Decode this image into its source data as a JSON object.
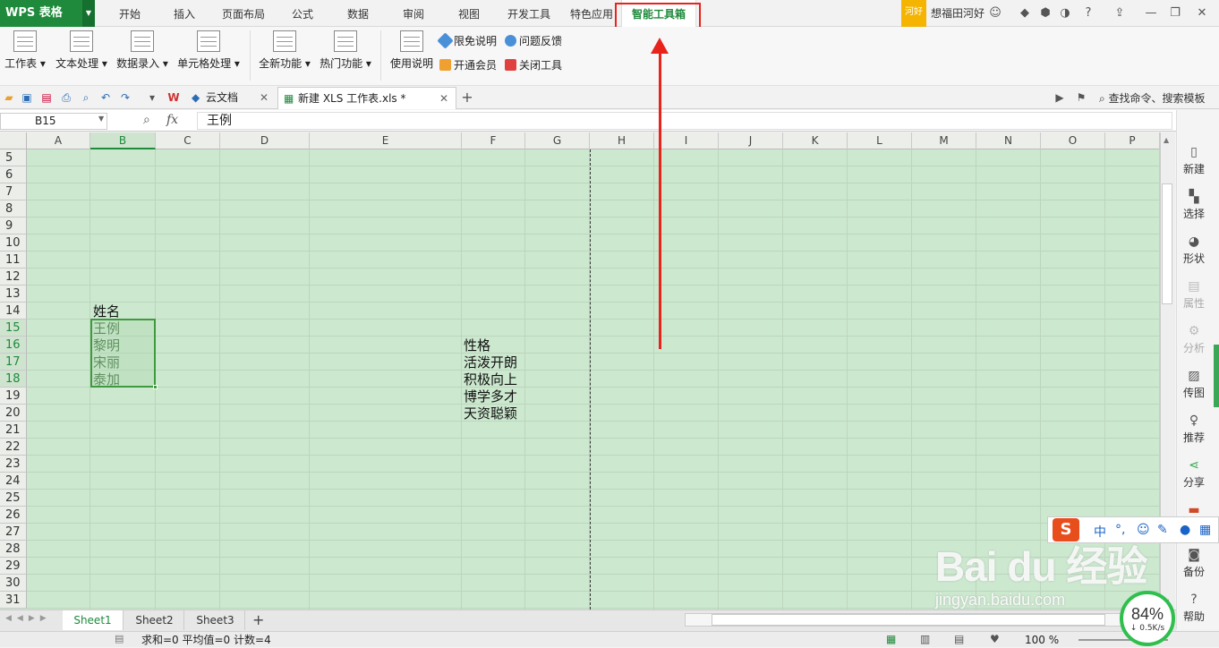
{
  "app": {
    "logo": "WPS 表格"
  },
  "menu_tabs": [
    "开始",
    "插入",
    "页面布局",
    "公式",
    "数据",
    "审阅",
    "视图",
    "开发工具",
    "特色应用",
    "智能工具箱"
  ],
  "active_tab": "智能工具箱",
  "topbar": {
    "badge": "河好",
    "user": "想福田河好"
  },
  "ribbon": {
    "groups1": [
      "工作表",
      "文本处理",
      "数据录入",
      "单元格处理"
    ],
    "groups2": [
      "全新功能",
      "热门功能"
    ],
    "usage": "使用说明",
    "small": [
      "限免说明",
      "问题反馈",
      "开通会员",
      "关闭工具"
    ]
  },
  "doc_tabs": {
    "cloud": "云文档",
    "file": "新建 XLS 工作表.xls *",
    "search": "查找命令、搜索模板"
  },
  "formula_bar": {
    "cell_ref": "B15",
    "fx": "fx",
    "value": "王例"
  },
  "columns": [
    "A",
    "B",
    "C",
    "D",
    "E",
    "F",
    "G",
    "H",
    "I",
    "J",
    "K",
    "L",
    "M",
    "N",
    "O",
    "P"
  ],
  "rows": [
    "5",
    "6",
    "7",
    "8",
    "9",
    "10",
    "11",
    "12",
    "13",
    "14",
    "15",
    "16",
    "17",
    "18",
    "19",
    "20",
    "21",
    "22",
    "23",
    "24",
    "25",
    "26",
    "27",
    "28",
    "29",
    "30",
    "31"
  ],
  "cells": {
    "b14": "姓名",
    "b15": "王例",
    "b16": "黎明",
    "b17": "宋丽",
    "b18": "泰加",
    "f16": "性格",
    "f17": "活泼开朗",
    "f18": "积极向上",
    "f19": "博学多才",
    "f20": "天资聪颖"
  },
  "right_panel": [
    "新建",
    "选择",
    "形状",
    "属性",
    "分析",
    "传图",
    "推荐",
    "分享",
    "备份",
    "帮助"
  ],
  "sheets": [
    "Sheet1",
    "Sheet2",
    "Sheet3"
  ],
  "status": {
    "summary": "求和=0  平均值=0  计数=4",
    "zoom": "100 %"
  },
  "speed": {
    "value": "84%",
    "rate": "↓ 0.5K/s"
  },
  "ime": {
    "mode": "中",
    "punct": "°,"
  },
  "watermark": {
    "brand": "Bai du 经验",
    "url": "jingyan.baidu.com"
  },
  "colors": {
    "accent": "#1f8a3c",
    "grid_bg": "#cce8cf",
    "highlight": "#e8231c"
  }
}
